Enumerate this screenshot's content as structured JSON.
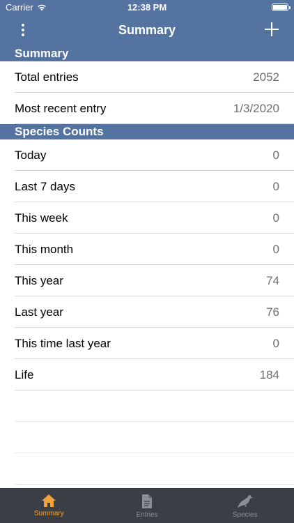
{
  "status_bar": {
    "carrier": "Carrier",
    "time": "12:38 PM"
  },
  "nav": {
    "title": "Summary"
  },
  "sections": {
    "summary": {
      "header": "Summary",
      "rows": [
        {
          "label": "Total entries",
          "value": "2052"
        },
        {
          "label": "Most recent entry",
          "value": "1/3/2020"
        }
      ]
    },
    "species_counts": {
      "header": "Species Counts",
      "rows": [
        {
          "label": "Today",
          "value": "0"
        },
        {
          "label": "Last 7 days",
          "value": "0"
        },
        {
          "label": "This week",
          "value": "0"
        },
        {
          "label": "This month",
          "value": "0"
        },
        {
          "label": "This year",
          "value": "74"
        },
        {
          "label": "Last year",
          "value": "76"
        },
        {
          "label": "This time last year",
          "value": "0"
        },
        {
          "label": "Life",
          "value": "184"
        }
      ]
    }
  },
  "tabs": [
    {
      "label": "Summary",
      "icon": "home-icon",
      "active": true
    },
    {
      "label": "Entries",
      "icon": "document-icon",
      "active": false
    },
    {
      "label": "Species",
      "icon": "bird-icon",
      "active": false
    }
  ],
  "colors": {
    "nav_background": "#5573a1",
    "tab_bar_background": "#3b3e45",
    "active_tab": "#f0a43a",
    "inactive_tab": "#8c8e94"
  }
}
